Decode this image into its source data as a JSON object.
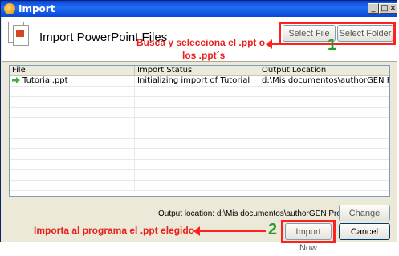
{
  "window": {
    "title": "Import"
  },
  "titlebar_buttons": {
    "minimize": "_",
    "maximize": "□",
    "close": "×"
  },
  "header": {
    "title": "Import PowerPoint Files"
  },
  "toolbar": {
    "select_file": "Select File",
    "select_folder": "Select Folder"
  },
  "annotations": {
    "step1_number": "1",
    "step1_text_line1": "Busca y selecciona el .ppt o",
    "step1_text_line2": "los .ppt´s",
    "step2_number": "2",
    "step2_text": "Importa al programa el .ppt elegido",
    "color_red": "#e8201c",
    "color_green": "#2a9a2a"
  },
  "table": {
    "columns": [
      "File",
      "Import Status",
      "Output Location"
    ],
    "rows": [
      {
        "file": "Tutorial.ppt",
        "status": "Initializing import of Tutorial",
        "location": "d:\\Mis documentos\\authorGEN Projects",
        "icon": "green-arrow-icon"
      }
    ]
  },
  "footer": {
    "output_label": "Output location:",
    "output_value": "d:\\Mis documentos\\authorGEN Projects",
    "change": "Change",
    "import_now": "Import Now",
    "cancel": "Cancel"
  }
}
